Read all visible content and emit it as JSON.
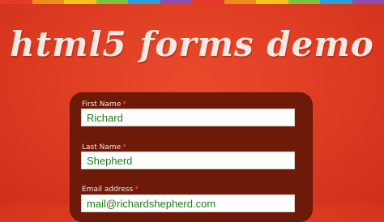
{
  "header": {
    "title": "html5 forms demo",
    "stripe_colors": [
      "#e53a2a",
      "#f08b1c",
      "#f6c51a",
      "#7cc242",
      "#2a9fd8",
      "#8b4fb3",
      "#e53a2a",
      "#f08b1c",
      "#f6c51a",
      "#7cc242",
      "#2a9fd8",
      "#8b4fb3"
    ]
  },
  "form": {
    "fields": [
      {
        "label": "First Name",
        "value": "Richard"
      },
      {
        "label": "Last Name",
        "value": "Shepherd"
      },
      {
        "label": "Email address",
        "value": "mail@richardshepherd.com"
      }
    ]
  }
}
